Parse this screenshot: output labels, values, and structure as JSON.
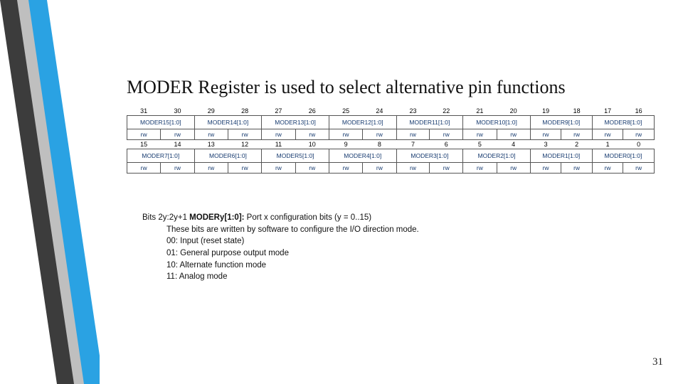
{
  "slide": {
    "title": "MODER Register is used to select alternative pin functions",
    "page_number": "31"
  },
  "register_table": {
    "bits_high": [
      "31",
      "30",
      "29",
      "28",
      "27",
      "26",
      "25",
      "24",
      "23",
      "22",
      "21",
      "20",
      "19",
      "18",
      "17",
      "16"
    ],
    "labels_high": [
      "MODER15[1:0]",
      "MODER14[1:0]",
      "MODER13[1:0]",
      "MODER12[1:0]",
      "MODER11[1:0]",
      "MODER10[1:0]",
      "MODER9[1:0]",
      "MODER8[1:0]"
    ],
    "rw_high": [
      "rw",
      "rw",
      "rw",
      "rw",
      "rw",
      "rw",
      "rw",
      "rw",
      "rw",
      "rw",
      "rw",
      "rw",
      "rw",
      "rw",
      "rw",
      "rw"
    ],
    "bits_low": [
      "15",
      "14",
      "13",
      "12",
      "11",
      "10",
      "9",
      "8",
      "7",
      "6",
      "5",
      "4",
      "3",
      "2",
      "1",
      "0"
    ],
    "labels_low": [
      "MODER7[1:0]",
      "MODER6[1:0]",
      "MODER5[1:0]",
      "MODER4[1:0]",
      "MODER3[1:0]",
      "MODER2[1:0]",
      "MODER1[1:0]",
      "MODER0[1:0]"
    ],
    "rw_low": [
      "rw",
      "rw",
      "rw",
      "rw",
      "rw",
      "rw",
      "rw",
      "rw",
      "rw",
      "rw",
      "rw",
      "rw",
      "rw",
      "rw",
      "rw",
      "rw"
    ]
  },
  "description": {
    "line1_prefix": "Bits 2y:2y+1 ",
    "line1_bold": "MODERy[1:0]:",
    "line1_suffix": " Port x configuration bits (y = 0..15)",
    "line2": "These bits are written by software to configure the I/O direction mode.",
    "line3": "00: Input (reset state)",
    "line4": "01: General purpose output mode",
    "line5": "10: Alternate function mode",
    "line6": "11: Analog mode"
  }
}
